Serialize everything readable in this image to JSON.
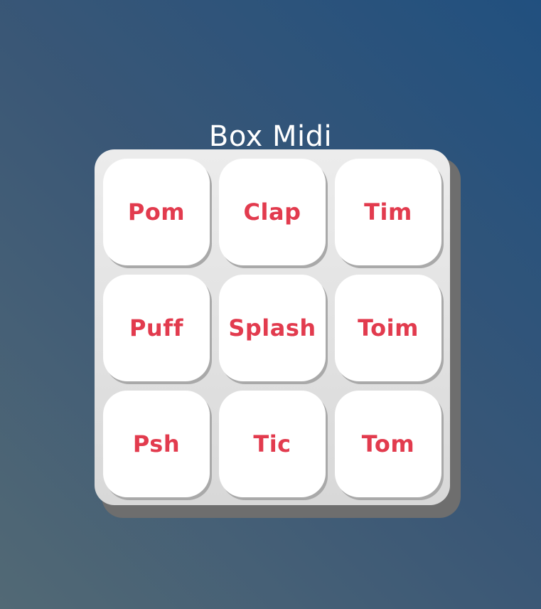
{
  "app": {
    "title": "Box Midi"
  },
  "colors": {
    "background_top_right": "#21507f",
    "background_bottom_left": "#526975",
    "pad_label": "#e23b4e",
    "pad_background": "#ffffff",
    "box_background": "#e4e4e4"
  },
  "pads": [
    {
      "label": "Pom"
    },
    {
      "label": "Clap"
    },
    {
      "label": "Tim"
    },
    {
      "label": "Puff"
    },
    {
      "label": "Splash"
    },
    {
      "label": "Toim"
    },
    {
      "label": "Psh"
    },
    {
      "label": "Tic"
    },
    {
      "label": "Tom"
    }
  ]
}
